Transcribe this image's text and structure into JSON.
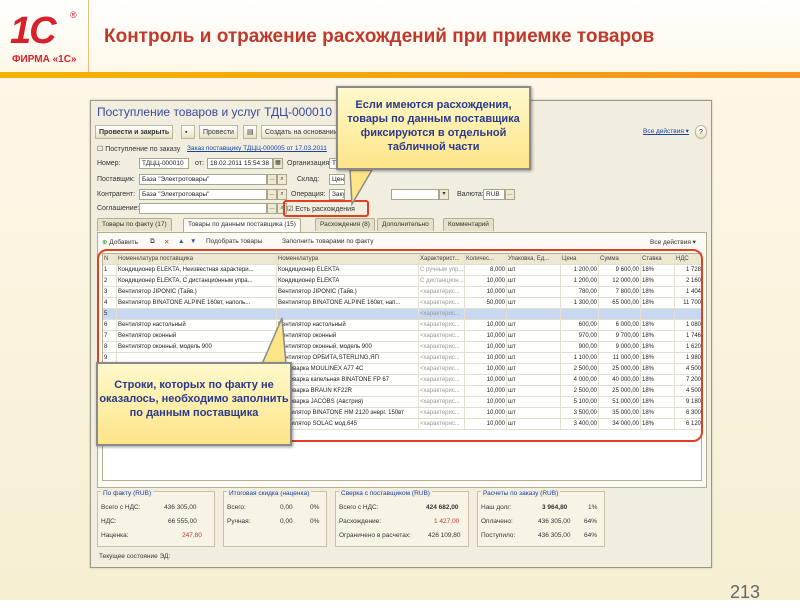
{
  "slide": {
    "title": "Контроль и отражение расхождений при приемке товаров",
    "logo": {
      "mark": "1С",
      "reg": "®",
      "firm": "ФИРМА «1С»"
    },
    "page_number": "213",
    "accent_colors": {
      "title": "#c0392b",
      "bar": "#f4b400",
      "highlight": "#e04020"
    }
  },
  "window": {
    "title": "Поступление товаров и услуг ТДЦ-000010 от 1",
    "toolbar": {
      "post_close": "Провести и закрыть",
      "post": "Провести",
      "create_based": "Создать на основании",
      "all_actions": "Все действия ▾",
      "help": "?"
    },
    "links": {
      "receipt_by_order": "Поступление по заказу",
      "order_link": "Заказ поставщику ТДЦЦ-000005 от 17.03.2011"
    },
    "fields": {
      "number_label": "Номер:",
      "number_value": "ТДЦЦ-000010",
      "date_label": "от:",
      "date_value": "18.02.2011 15:54:38",
      "org_label": "Организация:",
      "org_value": "Т",
      "supplier_label": "Поставщик:",
      "supplier_value": "База \"Электротовары\"",
      "warehouse_label": "Склад:",
      "warehouse_value": "Центральны",
      "contractor_label": "Контрагент:",
      "contractor_value": "База \"Электротовары\"",
      "operation_label": "Операция:",
      "operation_value": "Закупка у п",
      "currency_label": "Валюта:",
      "currency_value": "RUB",
      "agreement_label": "Соглашение:",
      "agreement_value": "",
      "discrepancy_checkbox": "Есть расхождения"
    },
    "tabs": [
      "Товары по факту (17)",
      "Товары по данным поставщика (15)",
      "Расхождения (8)",
      "Дополнительно",
      "Комментарий"
    ],
    "panel_toolbar": {
      "add": "Добавить",
      "pick": "Подобрать товары",
      "fill": "Заполнить товарами по факту",
      "all_actions": "Все действия ▾"
    },
    "grid": {
      "columns": [
        "N",
        "Номенклатура поставщика",
        "Номенклатура",
        "Характерист...",
        "Количес...",
        "Упаковка, Ед...",
        "Цена",
        "Сумма",
        "Ставка",
        "НДС"
      ],
      "rows": [
        {
          "n": "1",
          "supplier_item": "Кондиционер ELEKTA, Неизвестная характери...",
          "item": "Кондиционер ELEKTA",
          "char": "С ручным упр...",
          "qty": "8,000",
          "unit": "шт",
          "price": "1 200,00",
          "sum": "9 600,00",
          "rate": "18%",
          "vat": "1 728"
        },
        {
          "n": "2",
          "supplier_item": "Кондиционер ELEKTA, С дистанционным упра...",
          "item": "Кондиционер ELEKTA",
          "char": "С дистанцион...",
          "qty": "10,000",
          "unit": "шт",
          "price": "1 200,00",
          "sum": "12 000,00",
          "rate": "18%",
          "vat": "2 160"
        },
        {
          "n": "3",
          "supplier_item": "Вентилятор JIPONIC (Тайв.)",
          "item": "Вентилятор JIPONIC (Тайв.)",
          "char": "<характерис...",
          "qty": "10,000",
          "unit": "шт",
          "price": "780,00",
          "sum": "7 800,00",
          "rate": "18%",
          "vat": "1 404"
        },
        {
          "n": "4",
          "supplier_item": "Вентилятор BINATONE ALPINE 160вт, наполь...",
          "item": "Вентилятор BINATONE ALPINE 160вт, нап...",
          "char": "<характерис...",
          "qty": "50,000",
          "unit": "шт",
          "price": "1 300,00",
          "sum": "65 000,00",
          "rate": "18%",
          "vat": "11 700"
        },
        {
          "n": "5",
          "supplier_item": "",
          "item": "",
          "char": "<характерис...",
          "qty": "",
          "unit": "",
          "price": "",
          "sum": "",
          "rate": "",
          "vat": ""
        },
        {
          "n": "6",
          "supplier_item": "Вентилятор настольный",
          "item": "Вентилятор настольный",
          "char": "<характерис...",
          "qty": "10,000",
          "unit": "шт",
          "price": "600,00",
          "sum": "6 000,00",
          "rate": "18%",
          "vat": "1 080"
        },
        {
          "n": "7",
          "supplier_item": "Вентилятор оконный",
          "item": "Вентилятор оконный",
          "char": "<характерис...",
          "qty": "10,000",
          "unit": "шт",
          "price": "970,00",
          "sum": "9 700,00",
          "rate": "18%",
          "vat": "1 746"
        },
        {
          "n": "8",
          "supplier_item": "Вентилятор оконный, модель 900",
          "item": "Вентилятор оконный, модель 900",
          "char": "<характерис...",
          "qty": "10,000",
          "unit": "шт",
          "price": "900,00",
          "sum": "9 000,00",
          "rate": "18%",
          "vat": "1 620"
        },
        {
          "n": "9",
          "supplier_item": "",
          "item": "Вентилятор ОРБИТА,STERLING,ЯП",
          "char": "<характерис...",
          "qty": "10,000",
          "unit": "шт",
          "price": "1 100,00",
          "sum": "11 000,00",
          "rate": "18%",
          "vat": "1 980"
        },
        {
          "n": "10",
          "supplier_item": "",
          "item": "Кофеварка MOULINEX A77 4C",
          "char": "<характерис...",
          "qty": "10,000",
          "unit": "шт",
          "price": "2 500,00",
          "sum": "25 000,00",
          "rate": "18%",
          "vat": "4 500"
        },
        {
          "n": "11",
          "supplier_item": "",
          "item": "Кофеварка капельная BINATONE FP 67",
          "char": "<характерис...",
          "qty": "10,000",
          "unit": "шт",
          "price": "4 000,00",
          "sum": "40 000,00",
          "rate": "18%",
          "vat": "7 200"
        },
        {
          "n": "12",
          "supplier_item": "",
          "item": "Кофеварка BRAUN KF22R",
          "char": "<характерис...",
          "qty": "10,000",
          "unit": "шт",
          "price": "2 500,00",
          "sum": "25 000,00",
          "rate": "18%",
          "vat": "4 500"
        },
        {
          "n": "13",
          "supplier_item": "",
          "item": "Кофеварка JACOBS (Австрия)",
          "char": "<характерис...",
          "qty": "10,000",
          "unit": "шт",
          "price": "5 100,00",
          "sum": "51 000,00",
          "rate": "18%",
          "vat": "9 180"
        },
        {
          "n": "14",
          "supplier_item": "",
          "item": "Вентилятор BINATONE HM 2120 энерг. 150вт",
          "char": "<характерис...",
          "qty": "10,000",
          "unit": "шт",
          "price": "3 500,00",
          "sum": "35 000,00",
          "rate": "18%",
          "vat": "6 300"
        },
        {
          "n": "15",
          "supplier_item": "",
          "item": "Вентилятор SOLAC мод.645",
          "char": "<характерис...",
          "qty": "10,000",
          "unit": "шт",
          "price": "3 400,00",
          "sum": "34 000,00",
          "rate": "18%",
          "vat": "6 120"
        }
      ]
    },
    "totals": {
      "fact": {
        "title": "По факту (RUB)",
        "total_label": "Всего с НДС:",
        "total": "436 305,00",
        "vat_label": "НДС:",
        "vat": "66 555,00",
        "markup_label": "Наценка:",
        "markup": "247,80"
      },
      "discount": {
        "title": "Итоговая скидка (наценка)",
        "total_label": "Всего:",
        "total": "0,00",
        "total_pct": "0%",
        "manual_label": "Ручная:",
        "manual": "0,00",
        "manual_pct": "0%"
      },
      "reconciliation": {
        "title": "Сверка с поставщиком (RUB)",
        "total_label": "Всего с НДС:",
        "total": "424 682,00",
        "diff_label": "Расхождение:",
        "diff": "1 427,00",
        "limit_label": "Ограничено в расчетах:",
        "limit": "426 109,80"
      },
      "settlement": {
        "title": "Расчеты по заказу (RUB)",
        "debt_label": "Наш долг:",
        "debt": "3 964,80",
        "debt_pct": "1%",
        "paid_label": "Оплачено:",
        "paid": "436 305,00",
        "paid_pct": "64%",
        "received_label": "Поступило:",
        "received": "436 305,00",
        "received_pct": "64%"
      }
    },
    "status": "Текущее состояние ЭД:"
  },
  "callouts": {
    "top": "Если имеются расхождения, товары по данным поставщика фиксируются в отдельной табличной части",
    "bottom": "Строки, которых по факту не оказалось, необходимо заполнить по данным поставщика"
  }
}
